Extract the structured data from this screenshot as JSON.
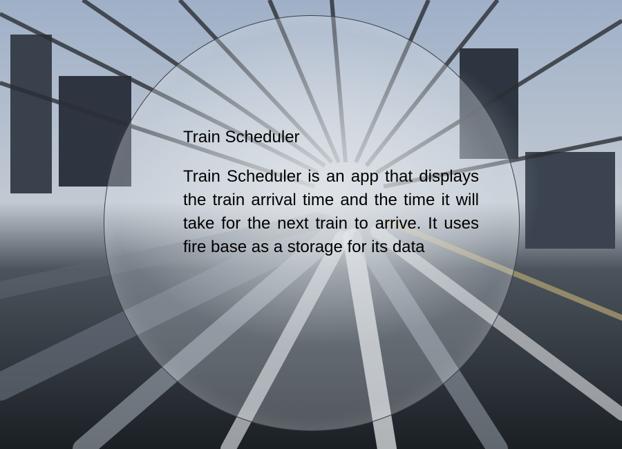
{
  "app": {
    "title": "Train Scheduler",
    "description": "Train  Scheduler is an app that displays the train arrival time and the time it will take for the next train to arrive. It uses fire base as a storage for its data"
  },
  "background": {
    "image": "train-tunnel-motion-photo"
  }
}
